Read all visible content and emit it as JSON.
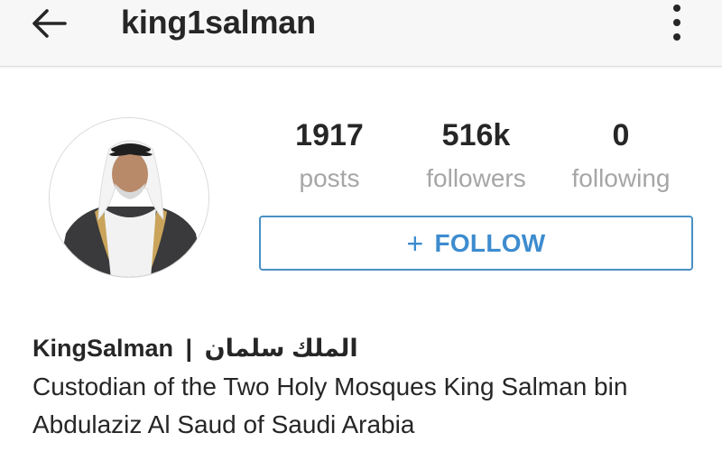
{
  "header": {
    "username": "king1salman",
    "back_icon": "arrow-left-icon",
    "menu_icon": "more-vertical-icon"
  },
  "profile": {
    "avatar_icon": "profile-photo",
    "stats": {
      "posts_count": "1917",
      "posts_label": "posts",
      "followers_count": "516k",
      "followers_label": "followers",
      "following_count": "0",
      "following_label": "following"
    },
    "follow_button": {
      "icon": "+",
      "label": "FOLLOW"
    }
  },
  "bio": {
    "name": "KingSalman",
    "separator": "|",
    "arabic_name": "الملك سلمان",
    "text": "Custodian of the Two Holy Mosques King Salman bin Abdulaziz Al Saud of Saudi Arabia"
  },
  "colors": {
    "accent": "#3d8ccf",
    "muted": "#a6a6a6",
    "text": "#262626",
    "header_bg": "#f7f7f7"
  }
}
